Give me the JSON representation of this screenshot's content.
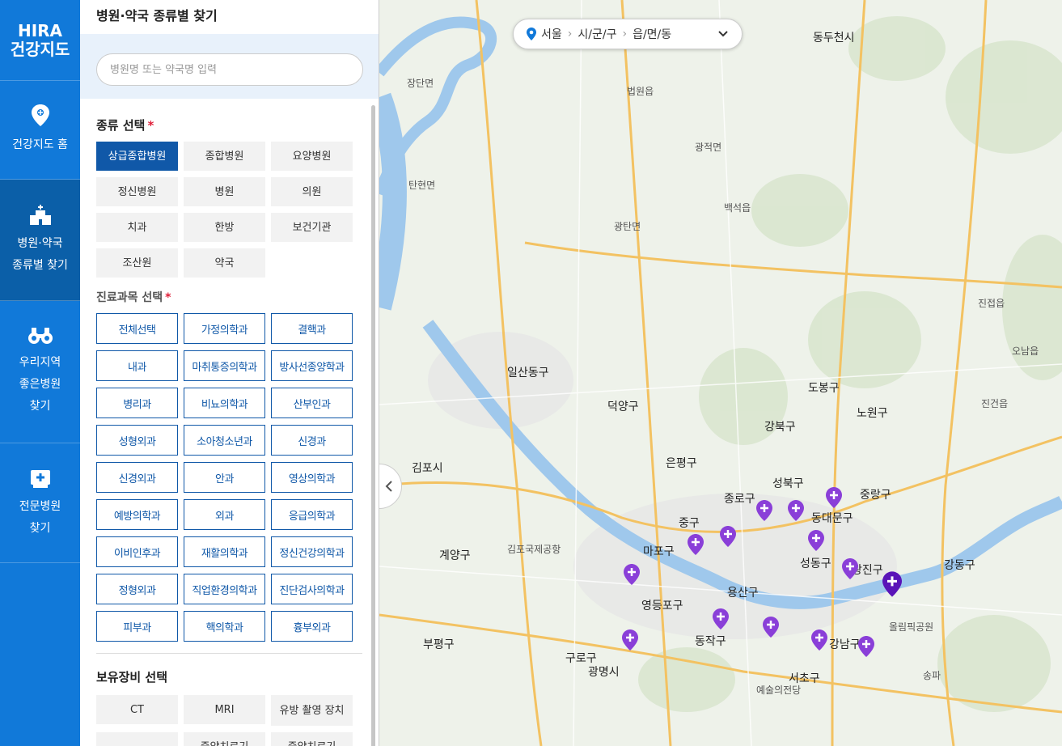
{
  "nav": {
    "logo_line1": "HIRA",
    "logo_line2": "건강지도",
    "items": [
      {
        "line1": "건강지도 홈",
        "line2": ""
      },
      {
        "line1": "병원·약국",
        "line2": "종류별 찾기"
      },
      {
        "line1": "우리지역",
        "line2": "좋은병원",
        "line3": "찾기"
      },
      {
        "line1": "전문병원",
        "line2": "찾기"
      }
    ]
  },
  "panel": {
    "title": "병원·약국 종류별 찾기",
    "search_placeholder": "병원명 또는 약국명 입력",
    "type_title": "종류 선택",
    "required_mark": "*",
    "types": [
      "상급종합병원",
      "종합병원",
      "요양병원",
      "정신병원",
      "병원",
      "의원",
      "치과",
      "한방",
      "보건기관",
      "조산원",
      "약국"
    ],
    "selected_type": "상급종합병원",
    "dept_title": "진료과목 선택",
    "depts": [
      "전체선택",
      "가정의학과",
      "결핵과",
      "내과",
      "마취통증의학과",
      "방사선종양학과",
      "병리과",
      "비뇨의학과",
      "산부인과",
      "성형외과",
      "소아청소년과",
      "신경과",
      "신경외과",
      "안과",
      "영상의학과",
      "예방의학과",
      "외과",
      "응급의학과",
      "이비인후과",
      "재활의학과",
      "정신건강의학과",
      "정형외과",
      "직업환경의학과",
      "진단검사의학과",
      "피부과",
      "핵의학과",
      "흉부외과"
    ],
    "equip_title": "보유장비 선택",
    "equips": [
      "CT",
      "MRI",
      "유방 촬영 장치",
      "",
      "증양치료기",
      "증양치료기"
    ]
  },
  "map": {
    "region_bar": {
      "city": "서울",
      "district": "시/군/구",
      "town": "읍/면/동"
    },
    "labels": {
      "dongducheon": "동두천시",
      "gimpo": "김포시",
      "gwangmyeong": "광명시",
      "ilsan": "일산동구",
      "deokyang": "덕양구",
      "jongno": "종로구",
      "jung": "중구",
      "yongsan": "용산구",
      "mapo": "마포구",
      "gangdong": "강동구",
      "seocho": "서초구",
      "gangnam": "강남구",
      "songpa": "송파",
      "nowon": "노원구",
      "dobong": "도봉구",
      "gangbuk": "강북구",
      "seongbuk": "성북구",
      "jungnang": "중랑구",
      "dongdaemun": "동대문구",
      "gwangjin": "광진구",
      "seongdong": "성동구",
      "yeongdeungpo": "영등포구",
      "guro": "구로구",
      "dongjak": "동작구",
      "gyeyang": "계양구",
      "bupyeong": "부평구",
      "gwangtan": "광탄면",
      "gwangjeok": "광적면",
      "baekseok": "백석읍",
      "beobwon": "법원읍",
      "tanhyeon": "탄현면",
      "jangdan": "장단면",
      "eunpyeong": "은평구",
      "jinjeop": "진접읍",
      "jingeon": "진건읍",
      "onam": "오남읍",
      "olympic": "올림픽공원",
      "artcenter": "예술의전당",
      "gimpo_airport": "김포국제공항"
    }
  },
  "colors": {
    "nav_bg": "#1179d9",
    "nav_active": "#0b5fa8",
    "selected_btn": "#1058a8",
    "required": "#e0203a",
    "pin": "#8a3fd8",
    "pin_dark": "#5a14b8",
    "river": "#9fc8ec"
  }
}
